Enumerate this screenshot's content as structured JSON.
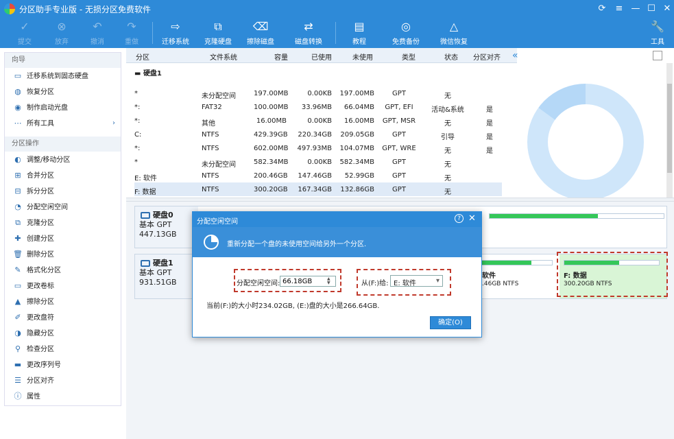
{
  "window": {
    "title": "分区助手专业版 - 无损分区免费软件",
    "icons": [
      "refresh-icon",
      "menu-icon",
      "minimize-icon",
      "maximize-icon",
      "close-icon"
    ]
  },
  "toolbar": {
    "commit": "提交",
    "discard": "放弃",
    "undo": "撤消",
    "redo": "重做",
    "migrate": "迁移系统",
    "clone": "克隆硬盘",
    "wipe": "擦除磁盘",
    "convert": "磁盘转换",
    "tutorial": "教程",
    "backup": "免费备份",
    "wechat": "微信恢复",
    "tools": "工具"
  },
  "sidebar": {
    "wizard_header": "向导",
    "wizard": [
      "迁移系统到固态硬盘",
      "恢复分区",
      "制作启动光盘",
      "所有工具"
    ],
    "ops_header": "分区操作",
    "ops": [
      "调整/移动分区",
      "合并分区",
      "拆分分区",
      "分配空闲空间",
      "克隆分区",
      "创建分区",
      "删除分区",
      "格式化分区",
      "更改卷标",
      "擦除分区",
      "更改盘符",
      "隐藏分区",
      "检查分区",
      "更改序列号",
      "分区对齐",
      "属性"
    ]
  },
  "table": {
    "headers": [
      "分区",
      "文件系统",
      "容量",
      "已使用",
      "未使用",
      "类型",
      "状态",
      "分区对齐"
    ],
    "disk_header": "硬盘1",
    "rows": [
      {
        "part": "*",
        "fs": "未分配空间",
        "cap": "197.00MB",
        "used": "0.00KB",
        "free": "197.00MB",
        "type": "GPT",
        "status": "无",
        "align": ""
      },
      {
        "part": "*:",
        "fs": "FAT32",
        "cap": "100.00MB",
        "used": "33.96MB",
        "free": "66.04MB",
        "type": "GPT, EFI",
        "status": "活动&系统",
        "align": "是"
      },
      {
        "part": "*:",
        "fs": "其他",
        "cap": "16.00MB",
        "used": "0.00KB",
        "free": "16.00MB",
        "type": "GPT, MSR",
        "status": "无",
        "align": "是"
      },
      {
        "part": "C:",
        "fs": "NTFS",
        "cap": "429.39GB",
        "used": "220.34GB",
        "free": "209.05GB",
        "type": "GPT",
        "status": "引导",
        "align": "是"
      },
      {
        "part": "*:",
        "fs": "NTFS",
        "cap": "602.00MB",
        "used": "497.93MB",
        "free": "104.07MB",
        "type": "GPT, WRE",
        "status": "无",
        "align": "是"
      },
      {
        "part": "*",
        "fs": "未分配空间",
        "cap": "582.34MB",
        "used": "0.00KB",
        "free": "582.34MB",
        "type": "GPT",
        "status": "无",
        "align": ""
      },
      {
        "part": "E: 软件",
        "fs": "NTFS",
        "cap": "200.46GB",
        "used": "147.46GB",
        "free": "52.99GB",
        "type": "GPT",
        "status": "无",
        "align": ""
      },
      {
        "part": "F: 数据",
        "fs": "NTFS",
        "cap": "300.20GB",
        "used": "167.34GB",
        "free": "132.86GB",
        "type": "GPT",
        "status": "无",
        "align": ""
      }
    ],
    "collapse_icon": "double-chevron-left-icon"
  },
  "disks": [
    {
      "name": "硬盘0",
      "type": "基本 GPT",
      "size": "447.13GB"
    },
    {
      "name": "硬盘1",
      "type": "基本 GPT",
      "size": "931.51GB",
      "e_name": "软件",
      "e_size": ".46GB NTFS",
      "f_name": "F: 数据",
      "f_size": "300.20GB NTFS"
    }
  ],
  "dialog": {
    "title": "分配空闲空间",
    "desc": "重新分配一个盘的未使用空间给另外一个分区.",
    "size_label": "分配空闲空间:",
    "size_value": "66.18GB",
    "from_label": "从(F:)给:",
    "from_value": "E: 软件",
    "info": "当前(F:)的大小时234.02GB, (E:)盘的大小是266.64GB.",
    "ok": "确定(O)"
  },
  "colors": {
    "accent": "#2e8ad8",
    "used_bar": "#34c759",
    "highlight": "#c0392b"
  }
}
